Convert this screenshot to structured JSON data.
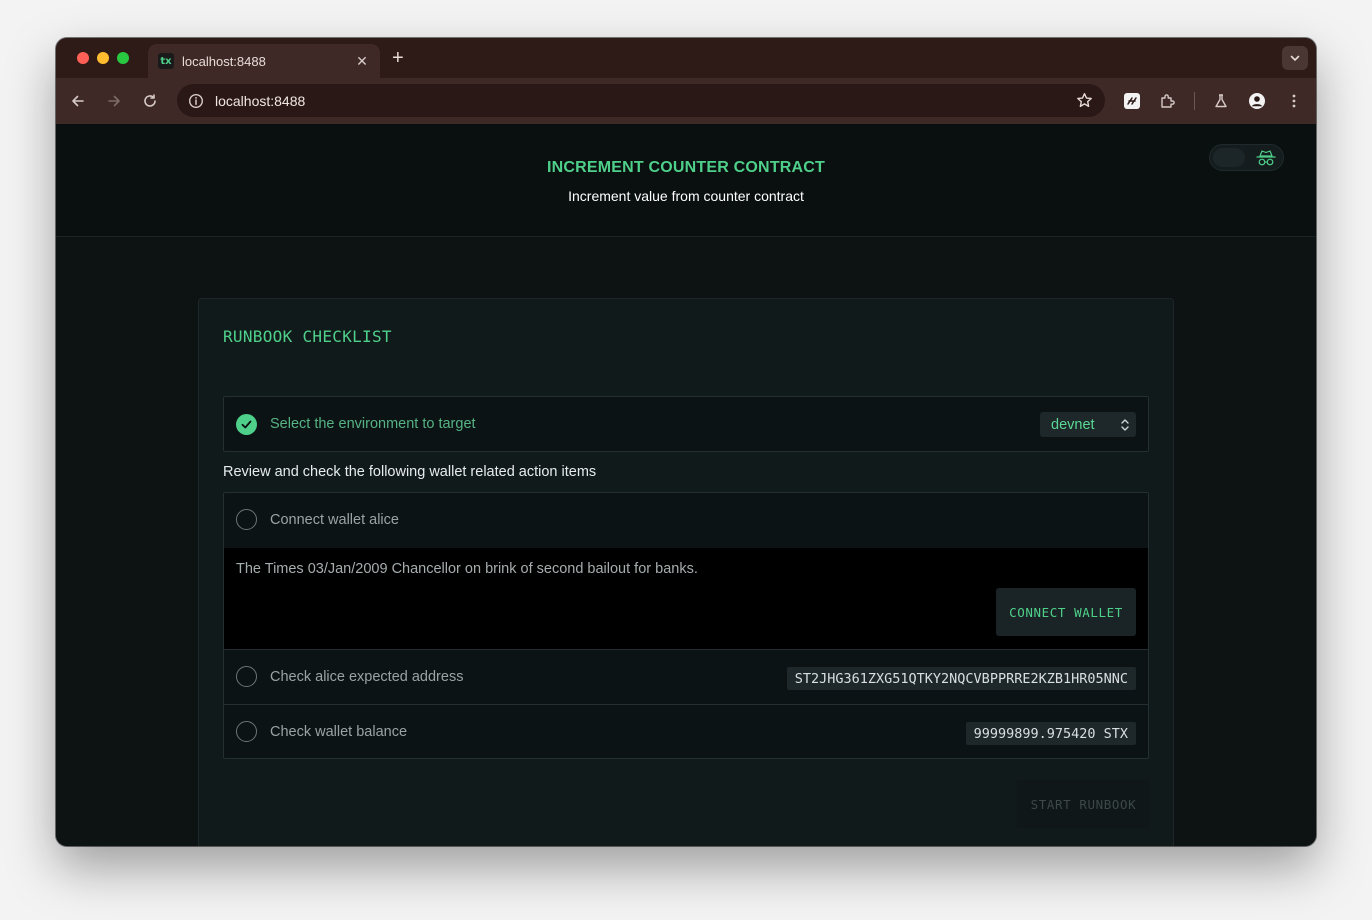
{
  "browser": {
    "tab_title": "localhost:8488",
    "favicon_text": "tx",
    "new_tab": "+",
    "tab_close": "✕",
    "url": "localhost:8488"
  },
  "header": {
    "title": "INCREMENT COUNTER CONTRACT",
    "subtitle": "Increment value from counter contract",
    "theme_icon": "incognito-hat-glasses-icon"
  },
  "checklist": {
    "title": "RUNBOOK CHECKLIST",
    "environment": {
      "label": "Select the environment to target",
      "value": "devnet",
      "checked": true
    },
    "review_label": "Review and check the following wallet related action items",
    "connect_wallet": {
      "label": "Connect wallet alice",
      "message": "The Times 03/Jan/2009 Chancellor on brink of second bailout for banks.",
      "button": "CONNECT WALLET"
    },
    "address": {
      "label": "Check alice expected address",
      "value": "ST2JHG361ZXG51QTKY2NQCVBPPRRE2KZB1HR05NNC"
    },
    "balance": {
      "label": "Check wallet balance",
      "value": "99999899.975420 STX"
    },
    "start_button": "START RUNBOOK"
  },
  "colors": {
    "accent": "#4fd08a",
    "page_bg": "#0d1213",
    "card_bg": "#111a1b",
    "browser_frame": "#3e2926"
  }
}
